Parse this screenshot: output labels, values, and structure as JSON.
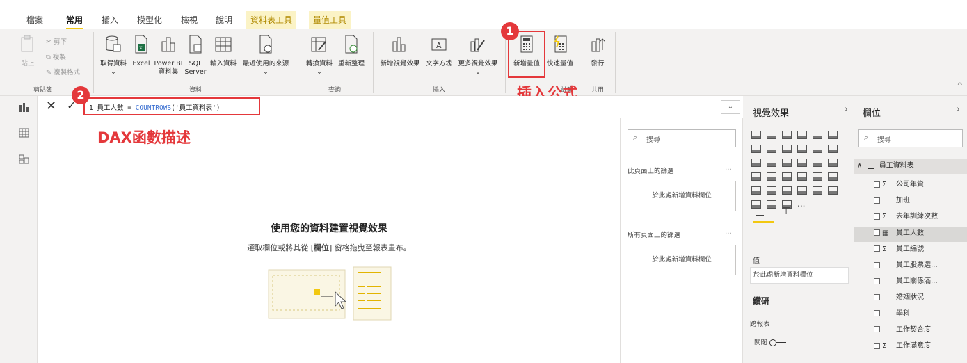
{
  "tabs": [
    "檔案",
    "常用",
    "插入",
    "模型化",
    "檢視",
    "說明",
    "資料表工具",
    "量值工具"
  ],
  "ribbon": {
    "clipboard": {
      "paste": "貼上",
      "cut": "剪下",
      "copy": "複製",
      "format_painter": "複製格式",
      "group": "剪貼簿"
    },
    "data": {
      "get_data": "取得資料",
      "excel": "Excel",
      "powerbi": "Power BI",
      "powerbi2": "資料集",
      "sql": "SQL",
      "sql2": "Server",
      "enter_data": "輸入資料",
      "recent": "最近使用的來源",
      "group": "資料"
    },
    "queries": {
      "transform": "轉換資料",
      "refresh": "重新整理",
      "group": "查詢"
    },
    "insert": {
      "new_visual": "新增視覺效果",
      "textbox": "文字方塊",
      "more_visuals": "更多視覺效果",
      "group": "插入"
    },
    "calc": {
      "new_measure": "新增量值",
      "quick_measure": "快速量值",
      "group": "計算"
    },
    "share": {
      "publish": "發行",
      "group": "共用"
    }
  },
  "formula": {
    "line_no": "1",
    "name": "員工人數 = ",
    "fn": "COUNTROWS",
    "arg": "('員工資料表')"
  },
  "annotations": {
    "badge1": "1",
    "badge2": "2",
    "insert_formula": "插入公式",
    "dax_desc": "DAX函數描述"
  },
  "canvas": {
    "title": "使用您的資料建置視覺效果",
    "subtitle_pre": "選取欄位或將其從 [",
    "subtitle_bold": "欄位",
    "subtitle_post": "] 窗格拖曳至報表畫布。"
  },
  "filters": {
    "search_placeholder": "搜尋",
    "this_page": "此頁面上的篩選",
    "all_pages": "所有頁面上的篩選",
    "add_field": "於此處新增資料欄位",
    "ellipsis": "..."
  },
  "viz": {
    "title": "視覺效果",
    "values_label": "值",
    "add_field": "於此處新增資料欄位",
    "drill": "鑽研",
    "cross_report": "跨報表",
    "off": "關閉",
    "more": "..."
  },
  "fields": {
    "title": "欄位",
    "search_placeholder": "搜尋",
    "table_name": "員工資料表",
    "items": [
      {
        "label": "公司年資",
        "sigma": "Σ"
      },
      {
        "label": "加班",
        "sigma": ""
      },
      {
        "label": "去年訓練次數",
        "sigma": "Σ"
      },
      {
        "label": "員工人數",
        "sigma": "▦"
      },
      {
        "label": "員工編號",
        "sigma": "Σ"
      },
      {
        "label": "員工股票選...",
        "sigma": ""
      },
      {
        "label": "員工關係滿...",
        "sigma": ""
      },
      {
        "label": "婚姻狀況",
        "sigma": ""
      },
      {
        "label": "學科",
        "sigma": ""
      },
      {
        "label": "工作契合度",
        "sigma": ""
      },
      {
        "label": "工作滿意度",
        "sigma": "Σ"
      }
    ]
  },
  "colors": {
    "accent": "#f2c811",
    "annotation": "#e4383b",
    "dax_fn": "#3a6fd1"
  }
}
